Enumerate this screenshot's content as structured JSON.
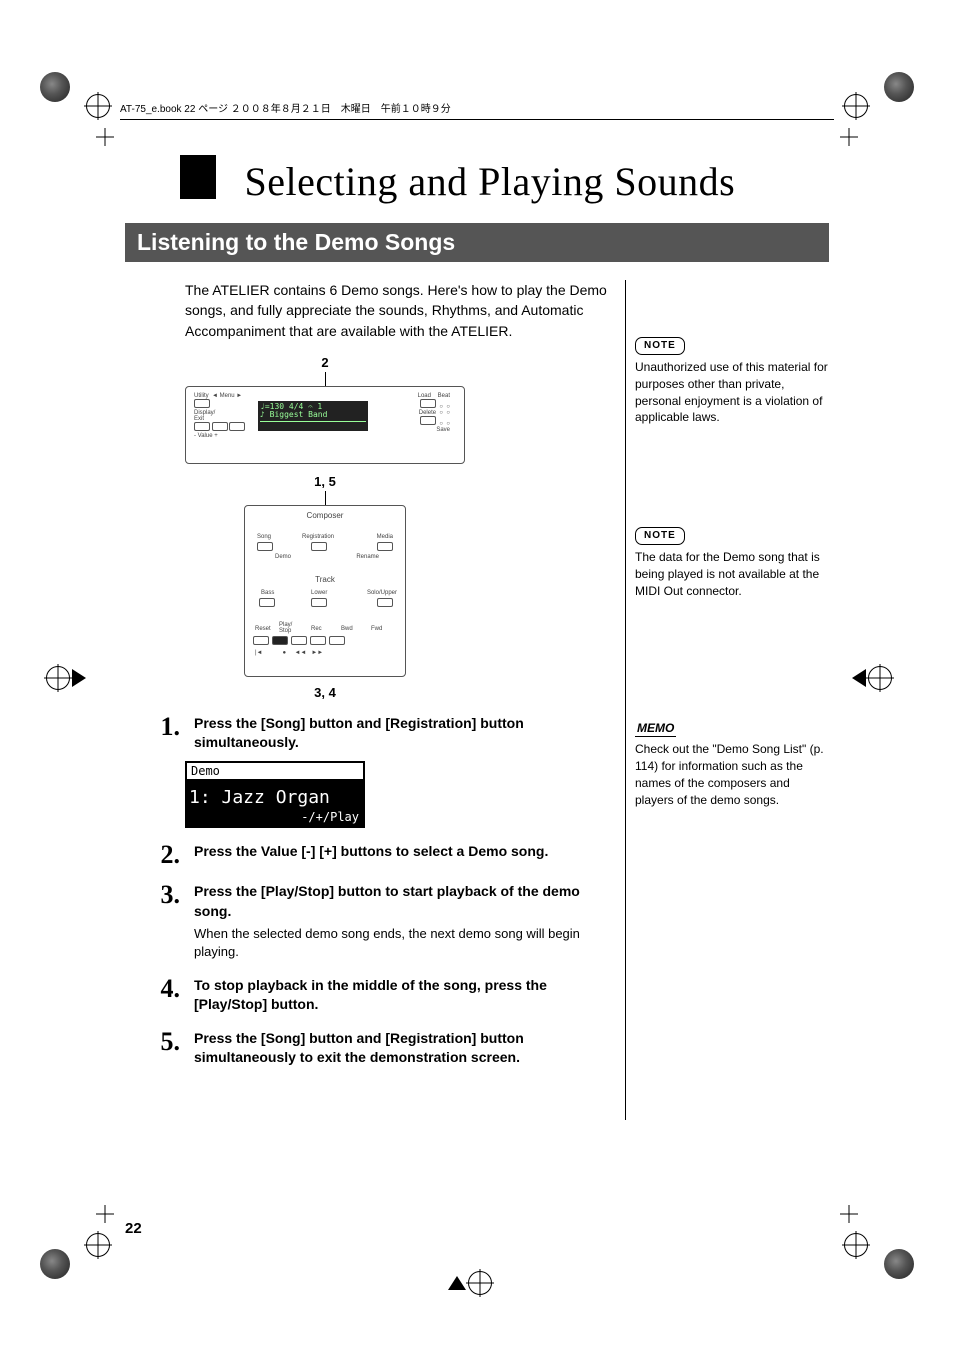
{
  "header": "AT-75_e.book 22 ページ ２００８年８月２１日　木曜日　午前１０時９分",
  "chapter_title": "Selecting and Playing Sounds",
  "section_title": "Listening to the Demo Songs",
  "intro": "The ATELIER contains 6 Demo songs. Here's how to play the Demo songs, and fully appreciate the sounds, Rhythms, and Automatic Accompaniment that are available with the ATELIER.",
  "diagram": {
    "callout_top": "2",
    "callout_mid": "1, 5",
    "callout_bottom": "3, 4",
    "lcd_line1": "♩=130    4/4 𝄐  1",
    "lcd_line2": "♪ Biggest Band",
    "labels": {
      "utility": "Utility",
      "menu": "◄ Menu ►",
      "display_exit": "Display/\nExit",
      "value": "- Value +",
      "load": "Load",
      "beat": "Beat",
      "save": "Save",
      "delete": "Delete",
      "composer": "Composer",
      "song": "Song",
      "registration": "Registration",
      "media": "Media",
      "demo": "Demo",
      "rename": "Rename",
      "track": "Track",
      "bass": "Bass",
      "lower": "Lower",
      "solo_upper": "Solo/Upper",
      "reset": "Reset",
      "play_stop": "Play/\nStop",
      "rec": "Rec",
      "bwd": "Bwd",
      "fwd": "Fwd"
    }
  },
  "demo_screen": {
    "title": "Demo",
    "line1": "1: Jazz Organ",
    "line2": "-/+/Play"
  },
  "steps": [
    {
      "num": "1.",
      "text": "Press the [Song] button and [Registration] button simultaneously."
    },
    {
      "num": "2.",
      "text": "Press the Value [-] [+] buttons to select a Demo song."
    },
    {
      "num": "3.",
      "text": "Press the [Play/Stop] button to start playback of the demo song.",
      "note": "When the selected demo song ends, the next demo song will begin playing."
    },
    {
      "num": "4.",
      "text": "To stop playback in the middle of the song, press the [Play/Stop] button."
    },
    {
      "num": "5.",
      "text": "Press the [Song] button and [Registration] button simultaneously to exit the demonstration screen."
    }
  ],
  "sidebar": [
    {
      "tag": "NOTE",
      "type": "note",
      "text": "Unauthorized use of this material for purposes other than private, personal enjoyment is a violation of applicable laws."
    },
    {
      "tag": "NOTE",
      "type": "note",
      "text": "The data for the Demo song that is being played is not available at the MIDI Out connector."
    },
    {
      "tag": "MEMO",
      "type": "memo",
      "text": "Check out the \"Demo Song List\" (p. 114) for information such as the names of the composers and players of the demo songs."
    }
  ],
  "page_number": "22"
}
